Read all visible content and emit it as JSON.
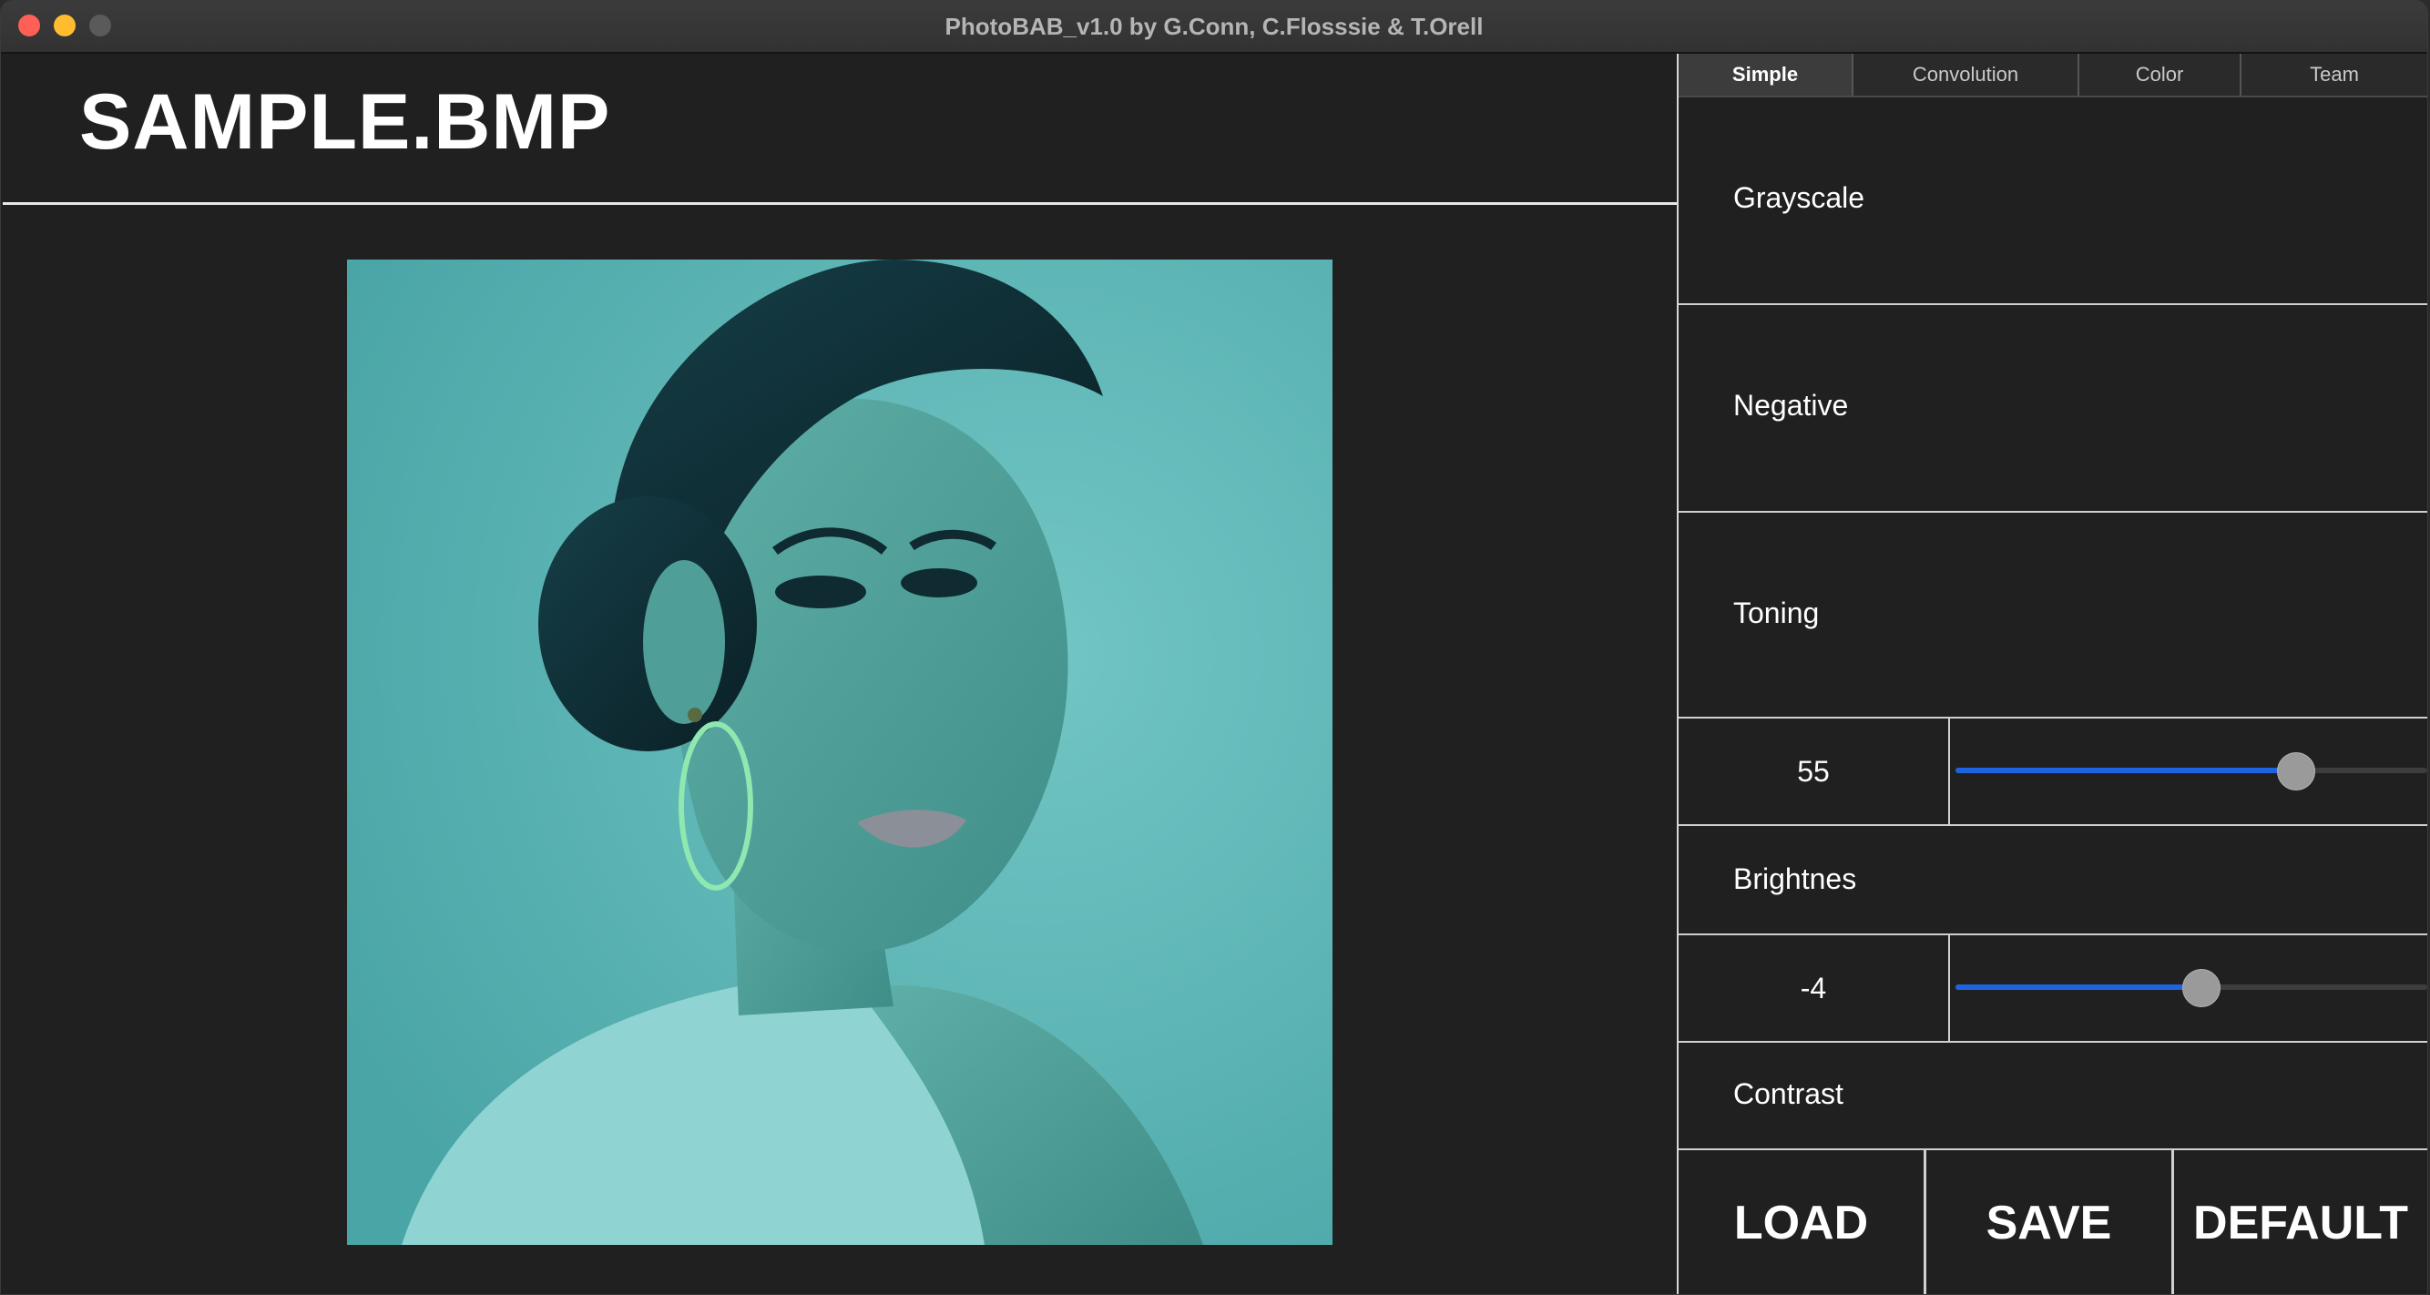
{
  "window": {
    "title": "PhotoBAB_v1.0 by G.Conn, C.Flosssie & T.Orell"
  },
  "image": {
    "filename": "SAMPLE.BMP",
    "tint": "#6cbcbc"
  },
  "tabs": [
    {
      "label": "Simple",
      "active": true
    },
    {
      "label": "Convolution",
      "active": false
    },
    {
      "label": "Color",
      "active": false
    },
    {
      "label": "Team",
      "active": false
    }
  ],
  "filters": {
    "grayscale": "Grayscale",
    "negative": "Negative",
    "toning": "Toning",
    "brightness": "Brightnes",
    "contrast": "Contrast"
  },
  "sliders": {
    "brightness": {
      "value": "55",
      "fraction": 0.72
    },
    "contrast": {
      "value": "-4",
      "fraction": 0.52
    }
  },
  "actions": {
    "load": "LOAD",
    "save": "SAVE",
    "default": "DEFAULT"
  },
  "colors": {
    "accent": "#1e63e0",
    "background": "#202020"
  }
}
